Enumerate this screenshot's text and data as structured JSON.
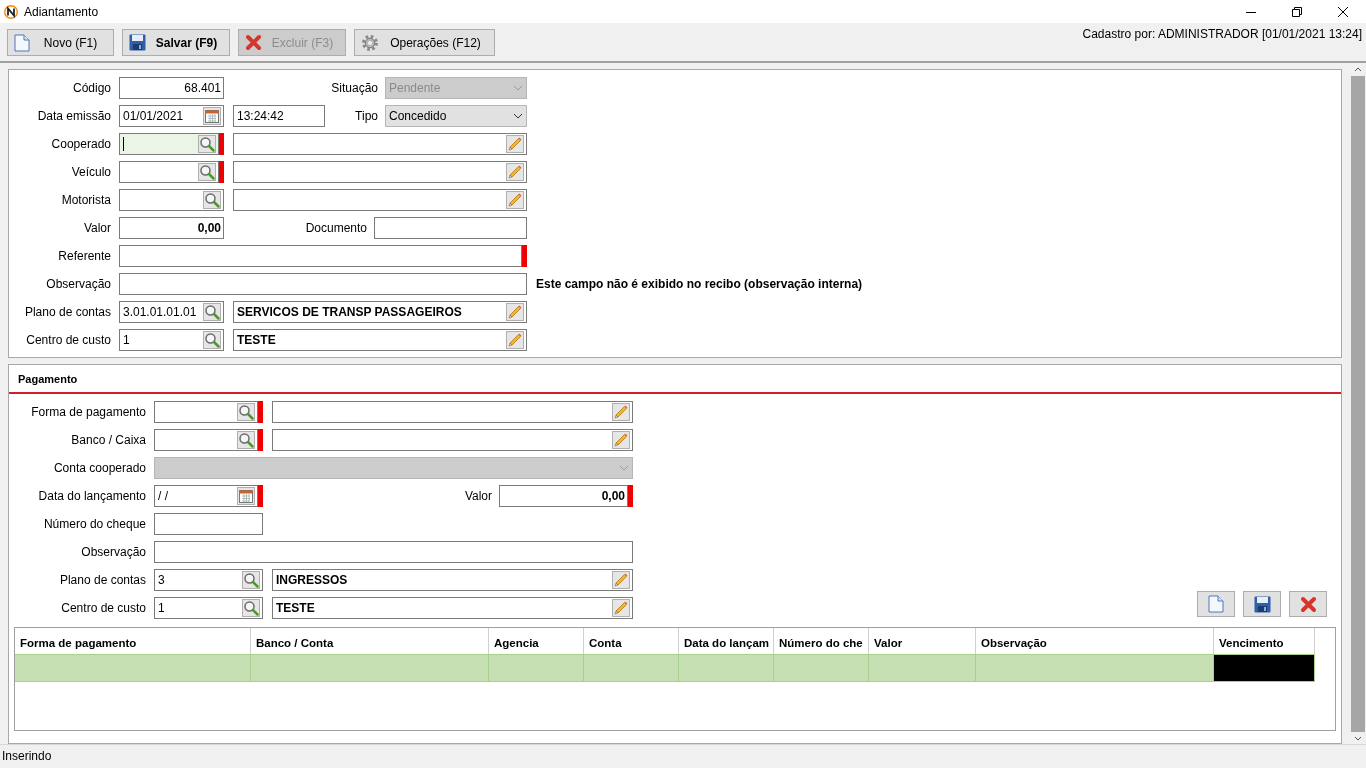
{
  "window": {
    "title": "Adiantamento"
  },
  "toolbar": {
    "buttons": [
      {
        "label": "Novo (F1)",
        "kind": "new",
        "disabled": false,
        "primary": false
      },
      {
        "label": "Salvar (F9)",
        "kind": "save",
        "disabled": false,
        "primary": true
      },
      {
        "label": "Excluir (F3)",
        "kind": "delete",
        "disabled": true,
        "primary": false
      },
      {
        "label": "Operações (F12)",
        "kind": "settings",
        "disabled": false,
        "primary": false
      }
    ],
    "created_by": "Cadastro por: ADMINISTRADOR [01/01/2021 13:24]"
  },
  "main_form": {
    "rows": [
      {
        "label": "Código",
        "fields": [
          {
            "kind": "number",
            "value": "68.401"
          },
          {
            "kind": "label",
            "text": "Situação"
          },
          {
            "kind": "select",
            "value": "Pendente",
            "disabled": true
          }
        ]
      },
      {
        "label": "Data emissão",
        "fields": [
          {
            "kind": "date",
            "value": "01/01/2021",
            "required": false
          },
          {
            "kind": "time",
            "value": "13:24:42"
          },
          {
            "kind": "label",
            "text": "Tipo"
          },
          {
            "kind": "select",
            "value": "Concedido",
            "disabled": false
          }
        ]
      },
      {
        "label": "Cooperado",
        "fields": [
          {
            "kind": "lookup",
            "required": true,
            "focused": true
          },
          {
            "kind": "description"
          }
        ]
      },
      {
        "label": "Veículo",
        "fields": [
          {
            "kind": "lookup",
            "required": true,
            "focused": false
          },
          {
            "kind": "description"
          }
        ]
      },
      {
        "label": "Motorista",
        "fields": [
          {
            "kind": "lookup",
            "focused": false
          },
          {
            "kind": "description"
          }
        ]
      },
      {
        "label": "Valor",
        "fields": [
          {
            "kind": "amount",
            "value": "0,00"
          },
          {
            "kind": "label",
            "text": "Documento"
          },
          {
            "kind": "input"
          }
        ]
      },
      {
        "label": "Referente",
        "fields": [
          {
            "kind": "wide",
            "required": true
          }
        ]
      },
      {
        "label": "Observação",
        "fields": [
          {
            "kind": "wide"
          }
        ],
        "note": "Este campo não é exibido no recibo (observação interna)"
      },
      {
        "label": "Plano de contas",
        "fields": [
          {
            "kind": "lookup",
            "value": "3.01.01.01.01",
            "focused": false
          },
          {
            "kind": "description",
            "value": "SERVICOS DE TRANSP PASSAGEIROS"
          }
        ]
      },
      {
        "label": "Centro de custo",
        "fields": [
          {
            "kind": "lookup",
            "value": "1",
            "focused": false
          },
          {
            "kind": "description",
            "value": "TESTE"
          }
        ]
      }
    ]
  },
  "payment": {
    "title": "Pagamento",
    "rows": [
      {
        "label": "Forma de pagamento",
        "fields": [
          {
            "kind": "lookup",
            "required": true,
            "focused": false
          },
          {
            "kind": "description"
          }
        ]
      },
      {
        "label": "Banco / Caixa",
        "fields": [
          {
            "kind": "lookup",
            "required": true,
            "focused": false
          },
          {
            "kind": "description"
          }
        ]
      },
      {
        "label": "Conta cooperado",
        "fields": [
          {
            "kind": "wide-select",
            "disabled": true
          }
        ]
      },
      {
        "label": "Data do lançamento",
        "fields": [
          {
            "kind": "date",
            "value": " / /",
            "required": true
          },
          {
            "kind": "label",
            "text": "Valor"
          },
          {
            "kind": "amount",
            "value": "0,00",
            "required": true
          }
        ]
      },
      {
        "label": "Número do cheque",
        "fields": [
          {
            "kind": "input"
          }
        ]
      },
      {
        "label": "Observação",
        "fields": [
          {
            "kind": "wide"
          }
        ]
      },
      {
        "label": "Plano de contas",
        "fields": [
          {
            "kind": "lookup",
            "value": "3",
            "focused": false
          },
          {
            "kind": "description",
            "value": "INGRESSOS"
          }
        ]
      },
      {
        "label": "Centro de custo",
        "fields": [
          {
            "kind": "lookup",
            "value": "1",
            "focused": false
          },
          {
            "kind": "description",
            "value": "TESTE"
          }
        ]
      }
    ],
    "actions": [
      {
        "kind": "new"
      },
      {
        "kind": "save"
      },
      {
        "kind": "delete"
      }
    ]
  },
  "grid": {
    "columns": [
      "Forma de pagamento",
      "Banco / Conta",
      "Agencia",
      "Conta",
      "Data do lançam",
      "Número do che",
      "Valor",
      "Observação",
      "Vencimento"
    ],
    "rows": [
      {
        "selected": true
      }
    ]
  },
  "status_bar": "Inserindo"
}
